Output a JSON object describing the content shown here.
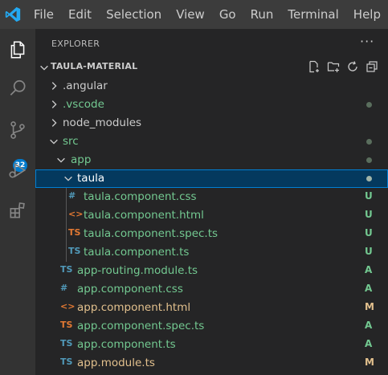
{
  "menubar": {
    "items": [
      "File",
      "Edit",
      "Selection",
      "View",
      "Go",
      "Run",
      "Terminal",
      "Help"
    ]
  },
  "activitybar": {
    "icons": [
      "explorer-icon",
      "search-icon",
      "source-control-icon",
      "run-debug-icon",
      "extensions-icon"
    ],
    "source_control_badge": "32"
  },
  "sidebar": {
    "title": "EXPLORER",
    "more_actions": "···",
    "section_title": "TAULA-MATERIAL",
    "header_actions": [
      "new-file-icon",
      "new-folder-icon",
      "refresh-icon",
      "collapse-all-icon"
    ]
  },
  "colors": {
    "untracked": "#73c991",
    "modified": "#e2c08d",
    "css": "#519aba",
    "html": "#e37933",
    "ts": "#519aba",
    "spec_ts": "#e37933",
    "dot": "#5a6e5d"
  },
  "tree": [
    {
      "label": ".angular",
      "kind": "folder",
      "expanded": false,
      "depth": 0
    },
    {
      "label": ".vscode",
      "kind": "folder",
      "expanded": false,
      "depth": 0,
      "dot": true
    },
    {
      "label": "node_modules",
      "kind": "folder",
      "expanded": false,
      "depth": 0
    },
    {
      "label": "src",
      "kind": "folder",
      "expanded": true,
      "depth": 0,
      "dot": true
    },
    {
      "label": "app",
      "kind": "folder",
      "expanded": true,
      "depth": 1,
      "dot": true
    },
    {
      "label": "taula",
      "kind": "folder",
      "expanded": true,
      "depth": 2,
      "dot": true,
      "selected": true
    },
    {
      "label": "taula.component.css",
      "kind": "css",
      "icon": "#",
      "depth": 3,
      "status": "U"
    },
    {
      "label": "taula.component.html",
      "kind": "html",
      "icon": "<>",
      "depth": 3,
      "status": "U"
    },
    {
      "label": "taula.component.spec.ts",
      "kind": "spec",
      "icon": "TS",
      "depth": 3,
      "status": "U"
    },
    {
      "label": "taula.component.ts",
      "kind": "ts",
      "icon": "TS",
      "depth": 3,
      "status": "U"
    },
    {
      "label": "app-routing.module.ts",
      "kind": "ts",
      "icon": "TS",
      "depth": 2,
      "status": "A"
    },
    {
      "label": "app.component.css",
      "kind": "css",
      "icon": "#",
      "depth": 2,
      "status": "A"
    },
    {
      "label": "app.component.html",
      "kind": "html",
      "icon": "<>",
      "depth": 2,
      "status": "M"
    },
    {
      "label": "app.component.spec.ts",
      "kind": "spec",
      "icon": "TS",
      "depth": 2,
      "status": "A"
    },
    {
      "label": "app.component.ts",
      "kind": "ts",
      "icon": "TS",
      "depth": 2,
      "status": "A"
    },
    {
      "label": "app.module.ts",
      "kind": "ts",
      "icon": "TS",
      "depth": 2,
      "status": "M"
    }
  ]
}
